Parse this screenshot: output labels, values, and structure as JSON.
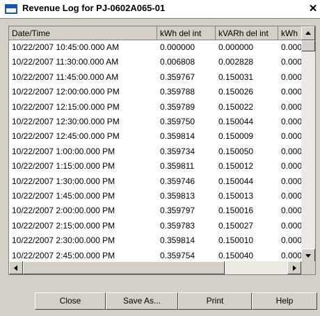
{
  "window": {
    "title": "Revenue Log for PJ-0602A065-01",
    "close_glyph": "✕"
  },
  "columns": [
    "Date/Time",
    "kWh del int",
    "kVARh del int",
    "kWh"
  ],
  "rows": [
    [
      "10/22/2007 10:45:00.000 AM",
      "0.000000",
      "0.000000",
      "0.000"
    ],
    [
      "10/22/2007 11:30:00.000 AM",
      "0.006808",
      "0.002828",
      "0.000"
    ],
    [
      "10/22/2007 11:45:00.000 AM",
      "0.359767",
      "0.150031",
      "0.000"
    ],
    [
      "10/22/2007 12:00:00.000 PM",
      "0.359788",
      "0.150026",
      "0.000"
    ],
    [
      "10/22/2007 12:15:00.000 PM",
      "0.359789",
      "0.150022",
      "0.000"
    ],
    [
      "10/22/2007 12:30:00.000 PM",
      "0.359750",
      "0.150044",
      "0.000"
    ],
    [
      "10/22/2007 12:45:00.000 PM",
      "0.359814",
      "0.150009",
      "0.000"
    ],
    [
      "10/22/2007 1:00:00.000 PM",
      "0.359734",
      "0.150050",
      "0.000"
    ],
    [
      "10/22/2007 1:15:00.000 PM",
      "0.359811",
      "0.150012",
      "0.000"
    ],
    [
      "10/22/2007 1:30:00.000 PM",
      "0.359746",
      "0.150044",
      "0.000"
    ],
    [
      "10/22/2007 1:45:00.000 PM",
      "0.359813",
      "0.150013",
      "0.000"
    ],
    [
      "10/22/2007 2:00:00.000 PM",
      "0.359797",
      "0.150016",
      "0.000"
    ],
    [
      "10/22/2007 2:15:00.000 PM",
      "0.359783",
      "0.150027",
      "0.000"
    ],
    [
      "10/22/2007 2:30:00.000 PM",
      "0.359814",
      "0.150010",
      "0.000"
    ],
    [
      "10/22/2007 2:45:00.000 PM",
      "0.359754",
      "0.150040",
      "0.000"
    ]
  ],
  "buttons": {
    "close": "Close",
    "save_as": "Save As...",
    "print": "Print",
    "help": "Help"
  },
  "icons": {
    "app": "window-icon",
    "close": "close-icon",
    "scroll_up": "arrow-up-icon",
    "scroll_down": "arrow-down-icon",
    "scroll_left": "arrow-left-icon",
    "scroll_right": "arrow-right-icon"
  },
  "colors": {
    "icon_accent": "#1a55b5",
    "face": "#d4d0c8"
  }
}
